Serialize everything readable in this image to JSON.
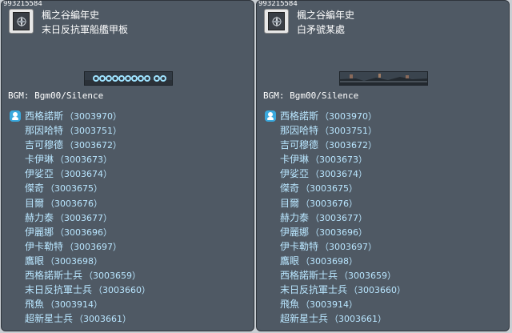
{
  "panels": [
    {
      "map_id": "993215584",
      "region": "楓之谷編年史",
      "map_name": "末日反抗軍船艦甲板",
      "bgm": "BGM: Bgm00/Silence",
      "npcs": [
        {
          "name": "西格諾斯",
          "id": "（3003970）"
        },
        {
          "name": "那因哈特",
          "id": "（3003751）"
        },
        {
          "name": "吉可穆德",
          "id": "（3003672）"
        },
        {
          "name": "卡伊琳",
          "id": "（3003673）"
        },
        {
          "name": "伊娑亞",
          "id": "（3003674）"
        },
        {
          "name": "傑奇",
          "id": "（3003675）"
        },
        {
          "name": "目爾",
          "id": "（3003676）"
        },
        {
          "name": "赫力泰",
          "id": "（3003677）"
        },
        {
          "name": "伊麗娜",
          "id": "（3003696）"
        },
        {
          "name": "伊卡勒特",
          "id": "（3003697）"
        },
        {
          "name": "鷹眼",
          "id": "（3003698）"
        },
        {
          "name": "西格諾斯士兵",
          "id": "（3003659）"
        },
        {
          "name": "末日反抗軍士兵",
          "id": "（3003660）"
        },
        {
          "name": "飛魚",
          "id": "（3003914）"
        },
        {
          "name": "超新星士兵",
          "id": "（3003661）"
        }
      ]
    },
    {
      "map_id": "993215584",
      "region": "楓之谷編年史",
      "map_name": "白矛號某處",
      "bgm": "BGM: Bgm00/Silence",
      "npcs": [
        {
          "name": "西格諾斯",
          "id": "（3003970）"
        },
        {
          "name": "那因哈特",
          "id": "（3003751）"
        },
        {
          "name": "吉可穆德",
          "id": "（3003672）"
        },
        {
          "name": "卡伊琳",
          "id": "（3003673）"
        },
        {
          "name": "伊娑亞",
          "id": "（3003674）"
        },
        {
          "name": "傑奇",
          "id": "（3003675）"
        },
        {
          "name": "目爾",
          "id": "（3003676）"
        },
        {
          "name": "赫力泰",
          "id": "（3003677）"
        },
        {
          "name": "伊麗娜",
          "id": "（3003696）"
        },
        {
          "name": "伊卡勒特",
          "id": "（3003697）"
        },
        {
          "name": "鷹眼",
          "id": "（3003698）"
        },
        {
          "name": "西格諾斯士兵",
          "id": "（3003659）"
        },
        {
          "name": "末日反抗軍士兵",
          "id": "（3003660）"
        },
        {
          "name": "飛魚",
          "id": "（3003914）"
        },
        {
          "name": "超新星士兵",
          "id": "（3003661）"
        }
      ]
    }
  ],
  "colors": {
    "panel_bg": "#4f5964",
    "npc_text": "#b9e6ff",
    "npc_icon": "#39a9de"
  },
  "icons": {
    "map_icon": "compass-book-icon",
    "npc_icon": "npc-person-icon"
  }
}
